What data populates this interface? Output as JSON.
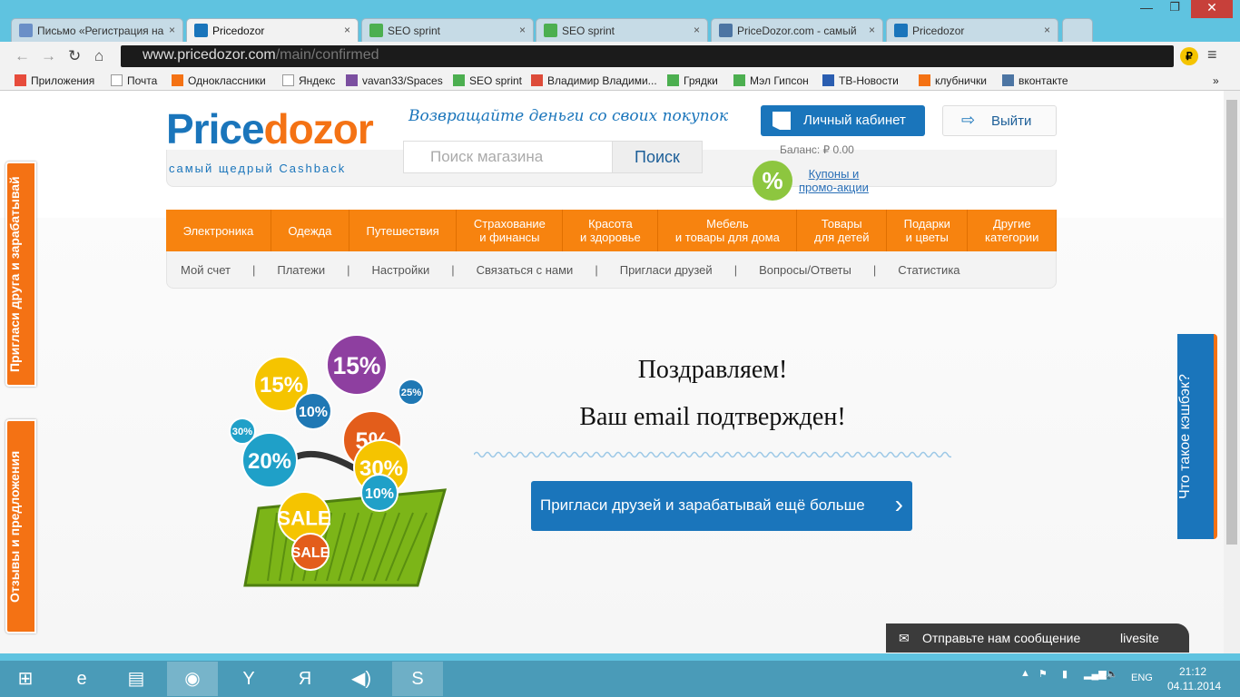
{
  "browser": {
    "tabs": [
      {
        "title": "Письмо «Регистрация на",
        "icon": "mail-icon",
        "color": "#6a8fc7"
      },
      {
        "title": "Pricedozor",
        "icon": "pricedozor-icon",
        "color": "#1a75bb",
        "active": true
      },
      {
        "title": "SEO sprint",
        "icon": "seosprint-icon",
        "color": "#4caf50"
      },
      {
        "title": "SEO sprint",
        "icon": "seosprint-icon",
        "color": "#4caf50"
      },
      {
        "title": "PriceDozor.com - самый",
        "icon": "vk-icon",
        "color": "#4c75a3"
      },
      {
        "title": "Pricedozor",
        "icon": "pricedozor-icon",
        "color": "#1a75bb"
      }
    ],
    "url_host": "www.pricedozor.com",
    "url_path": "/main/confirmed",
    "bookmarks": [
      "Приложения",
      "Почта",
      "Одноклассники",
      "Яндекс",
      "vavan33/Spaces",
      "SEO sprint",
      "Владимир Владими...",
      "Грядки",
      "Мэл Гипсон",
      "ТВ-Новости",
      "клубнички",
      "вконтакте"
    ],
    "more": "»"
  },
  "site": {
    "logo_price": "Price",
    "logo_dozor": "dozor",
    "logo_sub": "самый щедрый Cashback",
    "tagline": "Возвращайте деньги со своих покупок",
    "search_placeholder": "Поиск магазина",
    "search_button": "Поиск",
    "cabinet": "Личный кабинет",
    "logout": "Выйти",
    "balance": "Баланс: ₽ 0.00",
    "percent": "%",
    "coupons_1": "Купоны и",
    "coupons_2": "промо-акции",
    "menu": [
      [
        "Электроника",
        ""
      ],
      [
        "Одежда",
        ""
      ],
      [
        "Путешествия",
        ""
      ],
      [
        "Страхование",
        "и финансы"
      ],
      [
        "Красота",
        "и здоровье"
      ],
      [
        "Мебель",
        "и товары для дома"
      ],
      [
        "Товары",
        "для детей"
      ],
      [
        "Подарки",
        "и цветы"
      ],
      [
        "Другие",
        "категории"
      ]
    ],
    "submenu": [
      "Мой счет",
      "Платежи",
      "Настройки",
      "Связаться с нами",
      "Пригласи друзей",
      "Вопросы/Ответы",
      "Статистика"
    ],
    "submenu_sep": "|",
    "congrats": "Поздравляем!",
    "confirmed": "Ваш email подтвержден!",
    "cta": "Пригласи друзей и зарабатывай ещё больше",
    "badges": [
      "15%",
      "15%",
      "10%",
      "25%",
      "30%",
      "20%",
      "5%",
      "30%",
      "10%",
      "SALE"
    ],
    "left_tab_1": "Пригласи друга и зарабатывай",
    "left_tab_2": "Отзывы и предложения",
    "right_tab": "Что такое кэшбэк?",
    "chat": "Отправьте нам сообщение",
    "chat_brand": "livesite"
  },
  "taskbar": {
    "lang": "ENG",
    "time": "21:12",
    "date": "04.11.2014"
  }
}
